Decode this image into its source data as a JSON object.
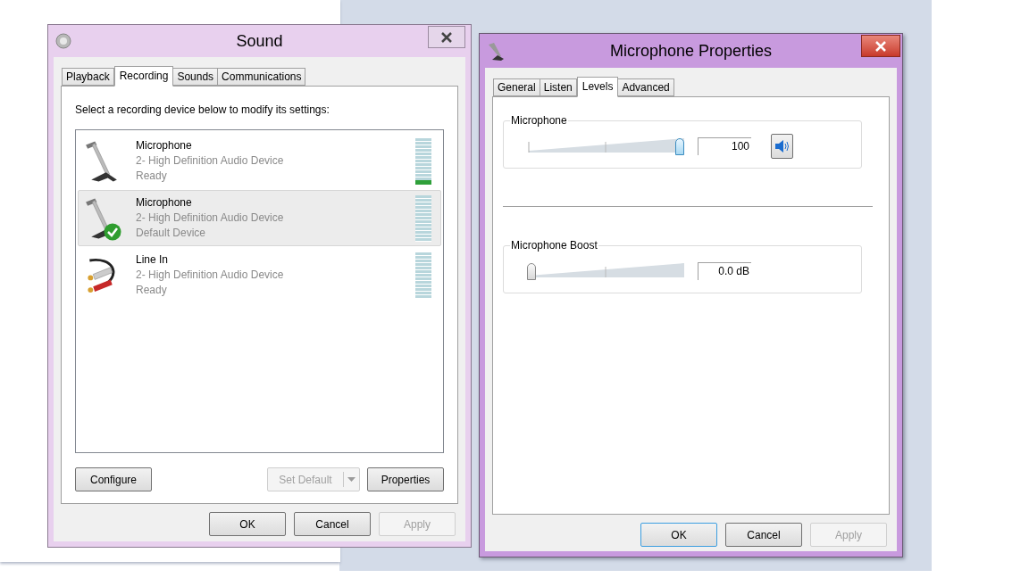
{
  "sound_window": {
    "title": "Sound",
    "tabs": [
      {
        "label": "Playback",
        "selected": false
      },
      {
        "label": "Recording",
        "selected": true
      },
      {
        "label": "Sounds",
        "selected": false
      },
      {
        "label": "Communications",
        "selected": false
      }
    ],
    "instruction": "Select a recording device below to modify its settings:",
    "devices": [
      {
        "kind": "microphone",
        "name": "Microphone",
        "description": "2- High Definition Audio Device",
        "status": "Ready",
        "default": false,
        "selected": false,
        "level": 0.08
      },
      {
        "kind": "microphone",
        "name": "Microphone",
        "description": "2- High Definition Audio Device",
        "status": "Default Device",
        "default": true,
        "selected": true
      },
      {
        "kind": "line_in",
        "name": "Line In",
        "description": "2- High Definition Audio Device",
        "status": "Ready",
        "default": false,
        "selected": false
      }
    ],
    "panel_buttons": [
      {
        "label": "Configure",
        "disabled": false,
        "dropdown": false
      },
      {
        "label": "Set Default",
        "disabled": true,
        "dropdown": true
      },
      {
        "label": "Properties",
        "disabled": false,
        "dropdown": false
      }
    ],
    "dialog_buttons": [
      {
        "label": "OK",
        "disabled": false,
        "focused": false
      },
      {
        "label": "Cancel",
        "disabled": false,
        "focused": false
      },
      {
        "label": "Apply",
        "disabled": true,
        "focused": false
      }
    ]
  },
  "properties_window": {
    "title": "Microphone Properties",
    "tabs": [
      {
        "label": "General",
        "selected": false
      },
      {
        "label": "Listen",
        "selected": false
      },
      {
        "label": "Levels",
        "selected": true
      },
      {
        "label": "Advanced",
        "selected": false
      }
    ],
    "controls": [
      {
        "label": "Microphone",
        "level": 1,
        "value": "100",
        "mute_button": true
      },
      {
        "label": "Microphone Boost",
        "level": 0,
        "value": "0.0 dB",
        "mute_button": false
      }
    ],
    "dialog_buttons": [
      {
        "label": "OK",
        "disabled": false,
        "focused": true
      },
      {
        "label": "Cancel",
        "disabled": false,
        "focused": false
      },
      {
        "label": "Apply",
        "disabled": true,
        "focused": false
      }
    ]
  }
}
